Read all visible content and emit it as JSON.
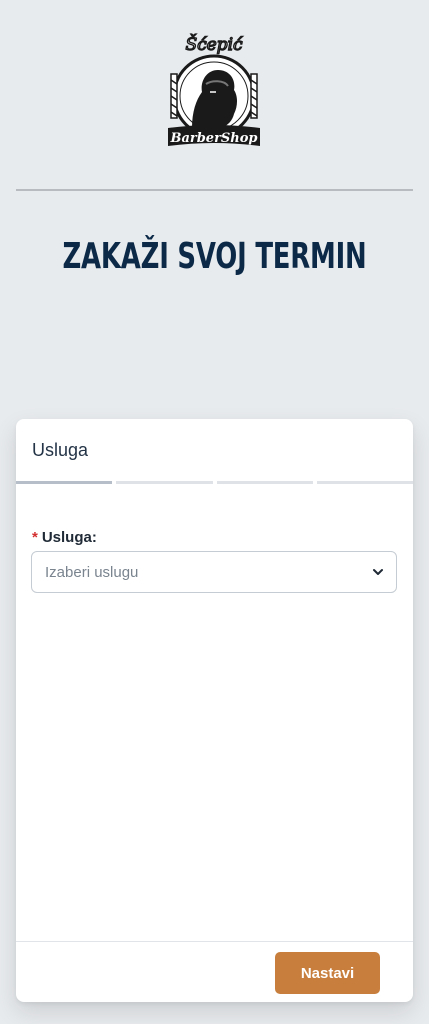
{
  "brand": {
    "logo_icon": "barber-shop-logo",
    "logo_text_top": "Šćepić",
    "logo_text_bottom": "BarberShop"
  },
  "page": {
    "title": "ZAKAŽI SVOJ TERMIN"
  },
  "wizard": {
    "step_title": "Usluga",
    "steps_total": 4,
    "active_step": 1
  },
  "form": {
    "service_label": "Usluga:",
    "required_marker": "*",
    "service_placeholder": "Izaberi uslugu",
    "chevron_icon": "chevron-down-icon"
  },
  "footer": {
    "next_label": "Nastavi"
  },
  "colors": {
    "page_bg": "#e8ebee",
    "title": "#0c2a48",
    "accent": "#c87f3d",
    "required": "#d32f2f"
  }
}
